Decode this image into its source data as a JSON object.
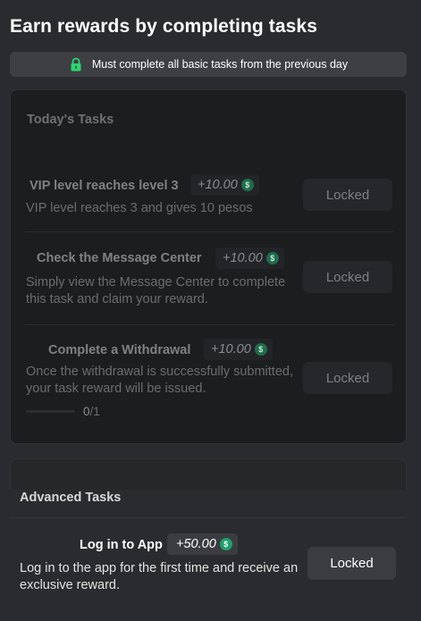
{
  "header": {
    "title": "Earn rewards by completing tasks"
  },
  "notice": {
    "icon": "lock-icon",
    "text": "Must complete all basic tasks from the previous day"
  },
  "today": {
    "title": "Today's Tasks",
    "tasks": [
      {
        "name": "VIP level reaches level 3",
        "reward": "+10.00",
        "description": "VIP level reaches 3 and gives 10 pesos",
        "button": "Locked"
      },
      {
        "name": "Check the Message Center",
        "reward": "+10.00",
        "description": "Simply view the Message Center to complete this task and claim your reward.",
        "button": "Locked"
      },
      {
        "name": "Complete a Withdrawal",
        "reward": "+10.00",
        "description": "Once the withdrawal is successfully submitted, your task reward will be issued.",
        "button": "Locked",
        "progress_current": "0",
        "progress_total": "/1"
      }
    ]
  },
  "advanced": {
    "title": "Advanced Tasks",
    "tasks": [
      {
        "name": "Log in to App",
        "reward": "+50.00",
        "description": "Log in to the app for the first time and receive an exclusive reward.",
        "button": "Locked"
      }
    ]
  },
  "coin_symbol": "$",
  "colors": {
    "background": "#2a2b2e",
    "card": "#1c1d1f",
    "coin_green": "#1fa06a",
    "lock_green": "#2fd46f"
  }
}
